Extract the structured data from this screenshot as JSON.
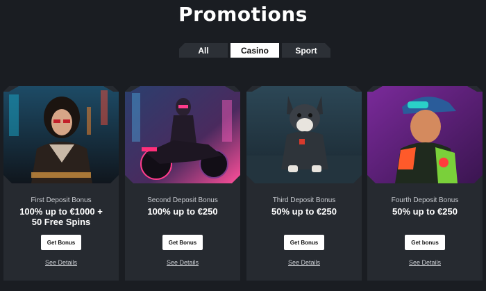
{
  "header": {
    "title": "Promotions"
  },
  "tabs": [
    {
      "label": "All",
      "active": false
    },
    {
      "label": "Casino",
      "active": true
    },
    {
      "label": "Sport",
      "active": false
    }
  ],
  "cards": [
    {
      "subtitle": "First Deposit Bonus",
      "title": "100% up to €1000 +\n50 Free Spins",
      "button": "Get Bonus",
      "link": "See Details"
    },
    {
      "subtitle": "Second Deposit Bonus",
      "title": "100% up to €250",
      "button": "Get Bonus",
      "link": "See Details"
    },
    {
      "subtitle": "Third Deposit Bonus",
      "title": "50% up to €250",
      "button": "Get Bonus",
      "link": "See Details"
    },
    {
      "subtitle": "Fourth Deposit Bonus",
      "title": "50% up to €250",
      "button": "Get bonus",
      "link": "See Details"
    }
  ],
  "colors": {
    "background": "#1a1d22",
    "card": "#262a30",
    "tab": "#2c3036",
    "accent": "#ff3c8c"
  }
}
